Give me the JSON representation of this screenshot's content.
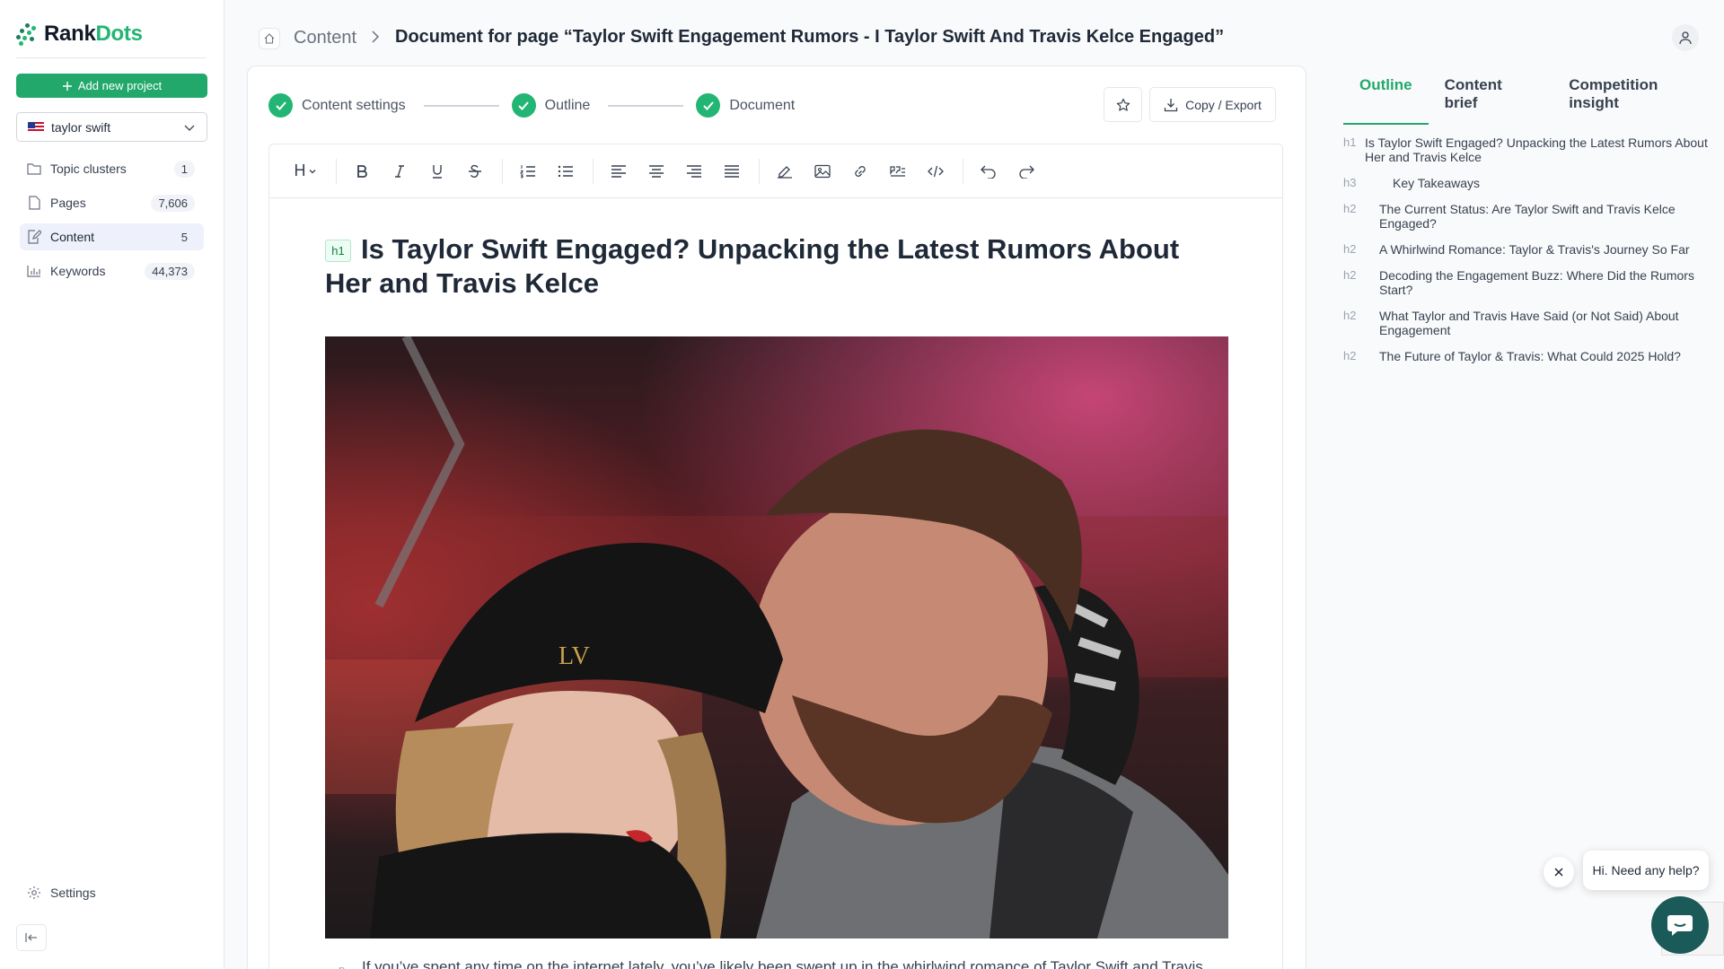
{
  "app": {
    "name_part1": "Rank",
    "name_part2": "Dots"
  },
  "sidebar": {
    "add_project_label": "Add new project",
    "project": "taylor swift",
    "items": [
      {
        "label": "Topic clusters",
        "count": "1"
      },
      {
        "label": "Pages",
        "count": "7,606"
      },
      {
        "label": "Content",
        "count": "5"
      },
      {
        "label": "Keywords",
        "count": "44,373"
      }
    ],
    "settings_label": "Settings"
  },
  "breadcrumb": {
    "root": "Content",
    "title": "Document for page “Taylor Swift Engagement Rumors - I Taylor Swift And Travis Kelce Engaged”"
  },
  "steps": [
    {
      "label": "Content settings"
    },
    {
      "label": "Outline"
    },
    {
      "label": "Document"
    }
  ],
  "actions": {
    "export_label": "Copy / Export"
  },
  "toolbar": {
    "heading_label": "H"
  },
  "document": {
    "h1_tag": "h1",
    "title": "Is Taylor Swift Engaged? Unpacking the Latest Rumors About Her and Travis Kelce",
    "para_tag": "p",
    "paragraph": "If you’ve spent any time on the internet lately, you’ve likely been swept up in the whirlwind romance of Taylor Swift and Travis"
  },
  "panel": {
    "tabs": [
      "Outline",
      "Content brief",
      "Competition insight"
    ],
    "outline": [
      {
        "tag": "h1",
        "text": "Is Taylor Swift Engaged? Unpacking the Latest Rumors About Her and Travis Kelce"
      },
      {
        "tag": "h3",
        "text": "Key Takeaways"
      },
      {
        "tag": "h2",
        "text": "The Current Status: Are Taylor Swift and Travis Kelce Engaged?"
      },
      {
        "tag": "h2",
        "text": "A Whirlwind Romance: Taylor & Travis's Journey So Far"
      },
      {
        "tag": "h2",
        "text": "Decoding the Engagement Buzz: Where Did the Rumors Start?"
      },
      {
        "tag": "h2",
        "text": "What Taylor and Travis Have Said (or Not Said) About Engagement"
      },
      {
        "tag": "h2",
        "text": "The Future of Taylor & Travis: What Could 2025 Hold?"
      }
    ]
  },
  "chat": {
    "prompt": "Hi. Need any help?"
  },
  "colors": {
    "accent": "#22a86b",
    "brand": "#22b573",
    "chat": "#1a5a58"
  },
  "icons": [
    "home-icon",
    "chevron-right-icon",
    "user-icon",
    "check-icon",
    "star-icon",
    "download-icon",
    "plus-icon",
    "chevron-down-icon",
    "folder-icon",
    "page-icon",
    "edit-icon",
    "bar-chart-icon",
    "gear-icon",
    "collapse-icon",
    "close-icon",
    "chat-icon"
  ]
}
